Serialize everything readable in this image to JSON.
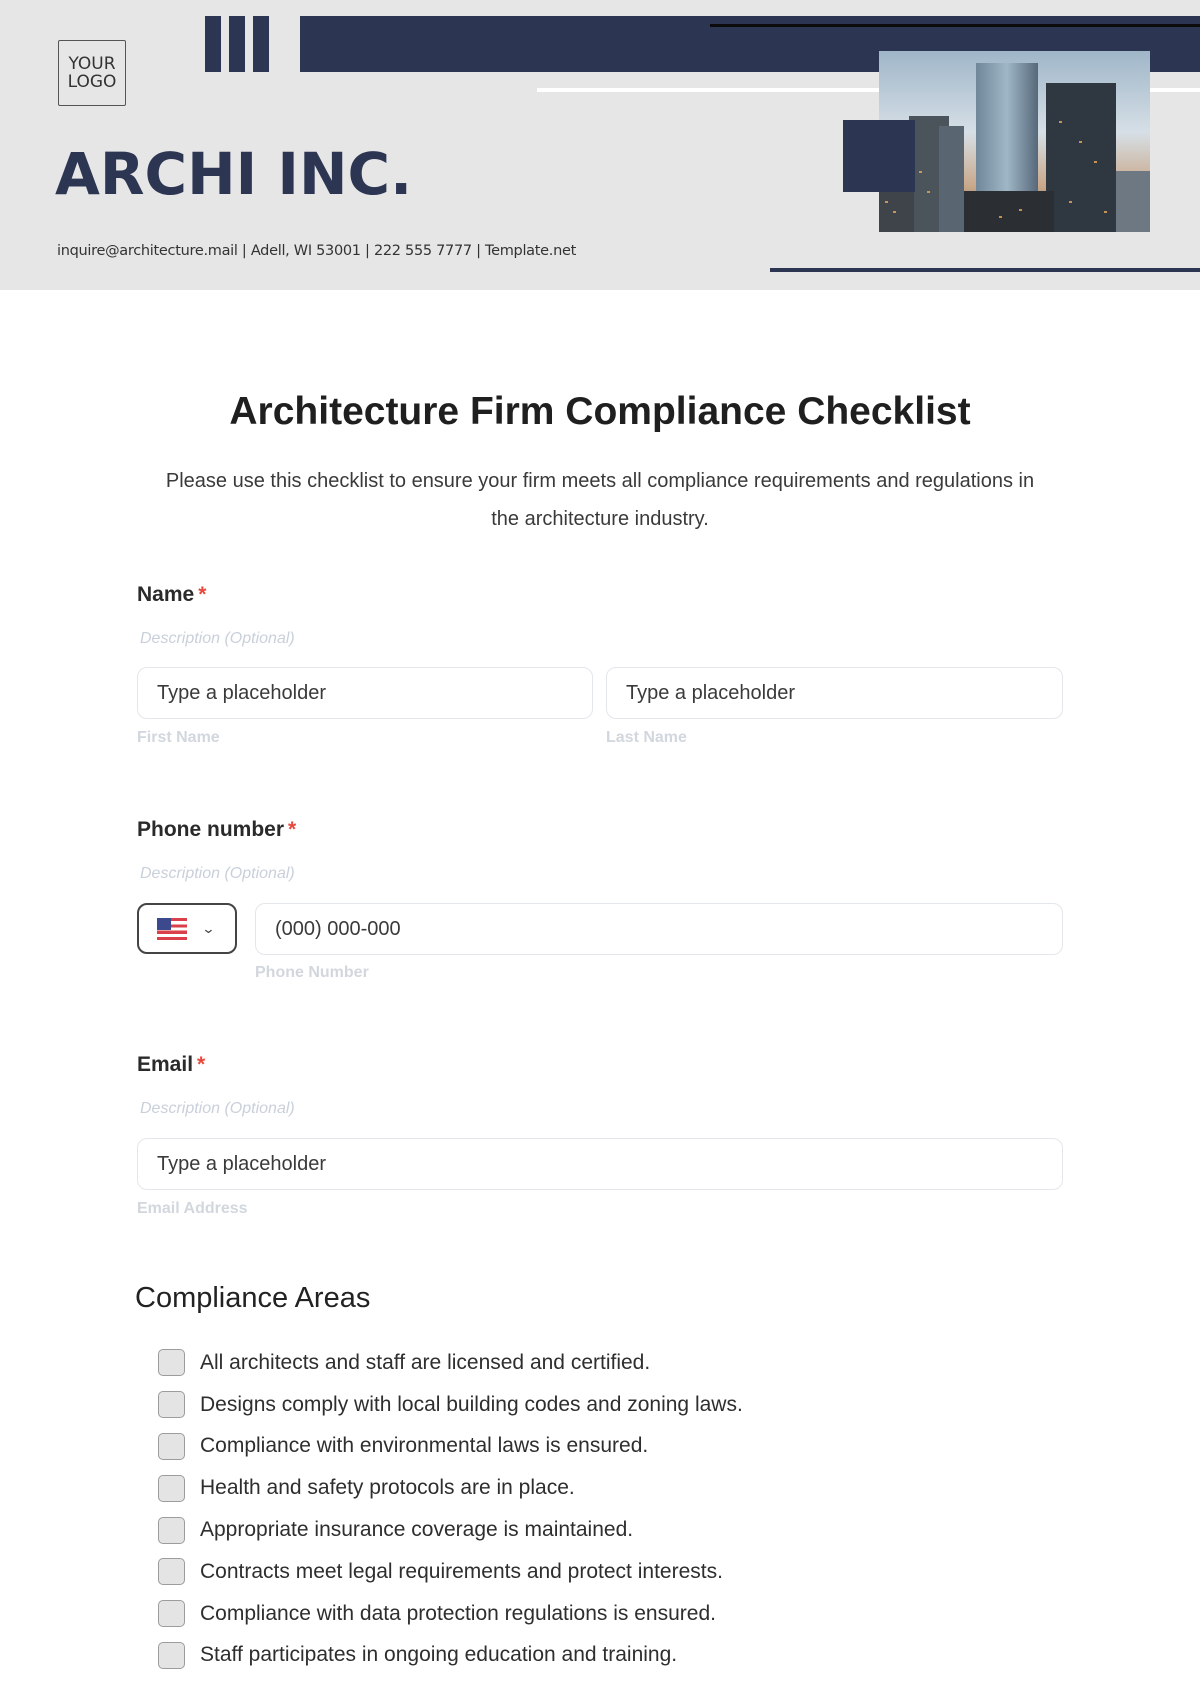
{
  "header": {
    "logo_text": "YOUR LOGO",
    "company_name": "ARCHI INC.",
    "contact_line": "inquire@architecture.mail | Adell, WI 53001 | 222 555 7777 | Template.net",
    "photo_alt": "city skyline photo",
    "brand_color": "#2c3653"
  },
  "form": {
    "title": "Architecture Firm Compliance Checklist",
    "intro": "Please use this checklist to ensure your firm meets all compliance requirements and regulations in the architecture industry.",
    "required_marker": "*",
    "name": {
      "label": "Name",
      "description": "Description (Optional)",
      "first": {
        "placeholder": "Type a placeholder",
        "sublabel": "First Name"
      },
      "last": {
        "placeholder": "Type a placeholder",
        "sublabel": "Last Name"
      }
    },
    "phone": {
      "label": "Phone number",
      "description": "Description (Optional)",
      "country": "US",
      "country_icon": "us-flag-icon",
      "dropdown_icon": "chevron-down-icon",
      "placeholder": "(000) 000-000",
      "sublabel": "Phone Number"
    },
    "email": {
      "label": "Email",
      "description": "Description (Optional)",
      "placeholder": "Type a placeholder",
      "sublabel": "Email Address"
    },
    "compliance": {
      "title": "Compliance Areas",
      "items": [
        {
          "label": "All architects and staff are licensed and certified.",
          "checked": false
        },
        {
          "label": "Designs comply with local building codes and zoning laws.",
          "checked": false
        },
        {
          "label": "Compliance with environmental laws is ensured.",
          "checked": false
        },
        {
          "label": "Health and safety protocols are in place.",
          "checked": false
        },
        {
          "label": "Appropriate insurance coverage is maintained.",
          "checked": false
        },
        {
          "label": "Contracts meet legal requirements and protect interests.",
          "checked": false
        },
        {
          "label": "Compliance with data protection regulations is ensured.",
          "checked": false
        },
        {
          "label": "Staff participates in ongoing education and training.",
          "checked": false
        }
      ]
    }
  }
}
